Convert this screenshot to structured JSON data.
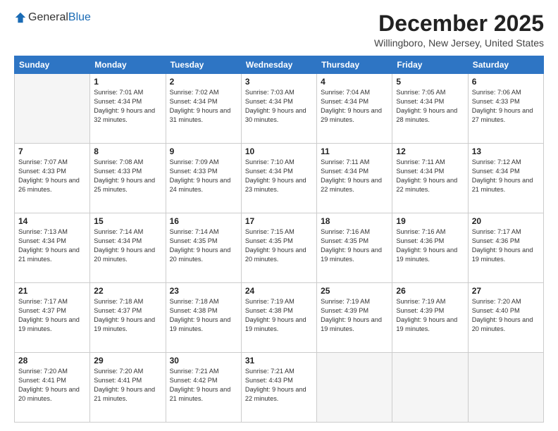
{
  "header": {
    "logo_general": "General",
    "logo_blue": "Blue",
    "month_year": "December 2025",
    "location": "Willingboro, New Jersey, United States"
  },
  "days_of_week": [
    "Sunday",
    "Monday",
    "Tuesday",
    "Wednesday",
    "Thursday",
    "Friday",
    "Saturday"
  ],
  "weeks": [
    [
      {
        "day": "",
        "sunrise": "",
        "sunset": "",
        "daylight": "",
        "empty": true
      },
      {
        "day": "1",
        "sunrise": "Sunrise: 7:01 AM",
        "sunset": "Sunset: 4:34 PM",
        "daylight": "Daylight: 9 hours and 32 minutes.",
        "empty": false
      },
      {
        "day": "2",
        "sunrise": "Sunrise: 7:02 AM",
        "sunset": "Sunset: 4:34 PM",
        "daylight": "Daylight: 9 hours and 31 minutes.",
        "empty": false
      },
      {
        "day": "3",
        "sunrise": "Sunrise: 7:03 AM",
        "sunset": "Sunset: 4:34 PM",
        "daylight": "Daylight: 9 hours and 30 minutes.",
        "empty": false
      },
      {
        "day": "4",
        "sunrise": "Sunrise: 7:04 AM",
        "sunset": "Sunset: 4:34 PM",
        "daylight": "Daylight: 9 hours and 29 minutes.",
        "empty": false
      },
      {
        "day": "5",
        "sunrise": "Sunrise: 7:05 AM",
        "sunset": "Sunset: 4:34 PM",
        "daylight": "Daylight: 9 hours and 28 minutes.",
        "empty": false
      },
      {
        "day": "6",
        "sunrise": "Sunrise: 7:06 AM",
        "sunset": "Sunset: 4:33 PM",
        "daylight": "Daylight: 9 hours and 27 minutes.",
        "empty": false
      }
    ],
    [
      {
        "day": "7",
        "sunrise": "Sunrise: 7:07 AM",
        "sunset": "Sunset: 4:33 PM",
        "daylight": "Daylight: 9 hours and 26 minutes.",
        "empty": false
      },
      {
        "day": "8",
        "sunrise": "Sunrise: 7:08 AM",
        "sunset": "Sunset: 4:33 PM",
        "daylight": "Daylight: 9 hours and 25 minutes.",
        "empty": false
      },
      {
        "day": "9",
        "sunrise": "Sunrise: 7:09 AM",
        "sunset": "Sunset: 4:33 PM",
        "daylight": "Daylight: 9 hours and 24 minutes.",
        "empty": false
      },
      {
        "day": "10",
        "sunrise": "Sunrise: 7:10 AM",
        "sunset": "Sunset: 4:34 PM",
        "daylight": "Daylight: 9 hours and 23 minutes.",
        "empty": false
      },
      {
        "day": "11",
        "sunrise": "Sunrise: 7:11 AM",
        "sunset": "Sunset: 4:34 PM",
        "daylight": "Daylight: 9 hours and 22 minutes.",
        "empty": false
      },
      {
        "day": "12",
        "sunrise": "Sunrise: 7:11 AM",
        "sunset": "Sunset: 4:34 PM",
        "daylight": "Daylight: 9 hours and 22 minutes.",
        "empty": false
      },
      {
        "day": "13",
        "sunrise": "Sunrise: 7:12 AM",
        "sunset": "Sunset: 4:34 PM",
        "daylight": "Daylight: 9 hours and 21 minutes.",
        "empty": false
      }
    ],
    [
      {
        "day": "14",
        "sunrise": "Sunrise: 7:13 AM",
        "sunset": "Sunset: 4:34 PM",
        "daylight": "Daylight: 9 hours and 21 minutes.",
        "empty": false
      },
      {
        "day": "15",
        "sunrise": "Sunrise: 7:14 AM",
        "sunset": "Sunset: 4:34 PM",
        "daylight": "Daylight: 9 hours and 20 minutes.",
        "empty": false
      },
      {
        "day": "16",
        "sunrise": "Sunrise: 7:14 AM",
        "sunset": "Sunset: 4:35 PM",
        "daylight": "Daylight: 9 hours and 20 minutes.",
        "empty": false
      },
      {
        "day": "17",
        "sunrise": "Sunrise: 7:15 AM",
        "sunset": "Sunset: 4:35 PM",
        "daylight": "Daylight: 9 hours and 20 minutes.",
        "empty": false
      },
      {
        "day": "18",
        "sunrise": "Sunrise: 7:16 AM",
        "sunset": "Sunset: 4:35 PM",
        "daylight": "Daylight: 9 hours and 19 minutes.",
        "empty": false
      },
      {
        "day": "19",
        "sunrise": "Sunrise: 7:16 AM",
        "sunset": "Sunset: 4:36 PM",
        "daylight": "Daylight: 9 hours and 19 minutes.",
        "empty": false
      },
      {
        "day": "20",
        "sunrise": "Sunrise: 7:17 AM",
        "sunset": "Sunset: 4:36 PM",
        "daylight": "Daylight: 9 hours and 19 minutes.",
        "empty": false
      }
    ],
    [
      {
        "day": "21",
        "sunrise": "Sunrise: 7:17 AM",
        "sunset": "Sunset: 4:37 PM",
        "daylight": "Daylight: 9 hours and 19 minutes.",
        "empty": false
      },
      {
        "day": "22",
        "sunrise": "Sunrise: 7:18 AM",
        "sunset": "Sunset: 4:37 PM",
        "daylight": "Daylight: 9 hours and 19 minutes.",
        "empty": false
      },
      {
        "day": "23",
        "sunrise": "Sunrise: 7:18 AM",
        "sunset": "Sunset: 4:38 PM",
        "daylight": "Daylight: 9 hours and 19 minutes.",
        "empty": false
      },
      {
        "day": "24",
        "sunrise": "Sunrise: 7:19 AM",
        "sunset": "Sunset: 4:38 PM",
        "daylight": "Daylight: 9 hours and 19 minutes.",
        "empty": false
      },
      {
        "day": "25",
        "sunrise": "Sunrise: 7:19 AM",
        "sunset": "Sunset: 4:39 PM",
        "daylight": "Daylight: 9 hours and 19 minutes.",
        "empty": false
      },
      {
        "day": "26",
        "sunrise": "Sunrise: 7:19 AM",
        "sunset": "Sunset: 4:39 PM",
        "daylight": "Daylight: 9 hours and 19 minutes.",
        "empty": false
      },
      {
        "day": "27",
        "sunrise": "Sunrise: 7:20 AM",
        "sunset": "Sunset: 4:40 PM",
        "daylight": "Daylight: 9 hours and 20 minutes.",
        "empty": false
      }
    ],
    [
      {
        "day": "28",
        "sunrise": "Sunrise: 7:20 AM",
        "sunset": "Sunset: 4:41 PM",
        "daylight": "Daylight: 9 hours and 20 minutes.",
        "empty": false
      },
      {
        "day": "29",
        "sunrise": "Sunrise: 7:20 AM",
        "sunset": "Sunset: 4:41 PM",
        "daylight": "Daylight: 9 hours and 21 minutes.",
        "empty": false
      },
      {
        "day": "30",
        "sunrise": "Sunrise: 7:21 AM",
        "sunset": "Sunset: 4:42 PM",
        "daylight": "Daylight: 9 hours and 21 minutes.",
        "empty": false
      },
      {
        "day": "31",
        "sunrise": "Sunrise: 7:21 AM",
        "sunset": "Sunset: 4:43 PM",
        "daylight": "Daylight: 9 hours and 22 minutes.",
        "empty": false
      },
      {
        "day": "",
        "sunrise": "",
        "sunset": "",
        "daylight": "",
        "empty": true
      },
      {
        "day": "",
        "sunrise": "",
        "sunset": "",
        "daylight": "",
        "empty": true
      },
      {
        "day": "",
        "sunrise": "",
        "sunset": "",
        "daylight": "",
        "empty": true
      }
    ]
  ]
}
